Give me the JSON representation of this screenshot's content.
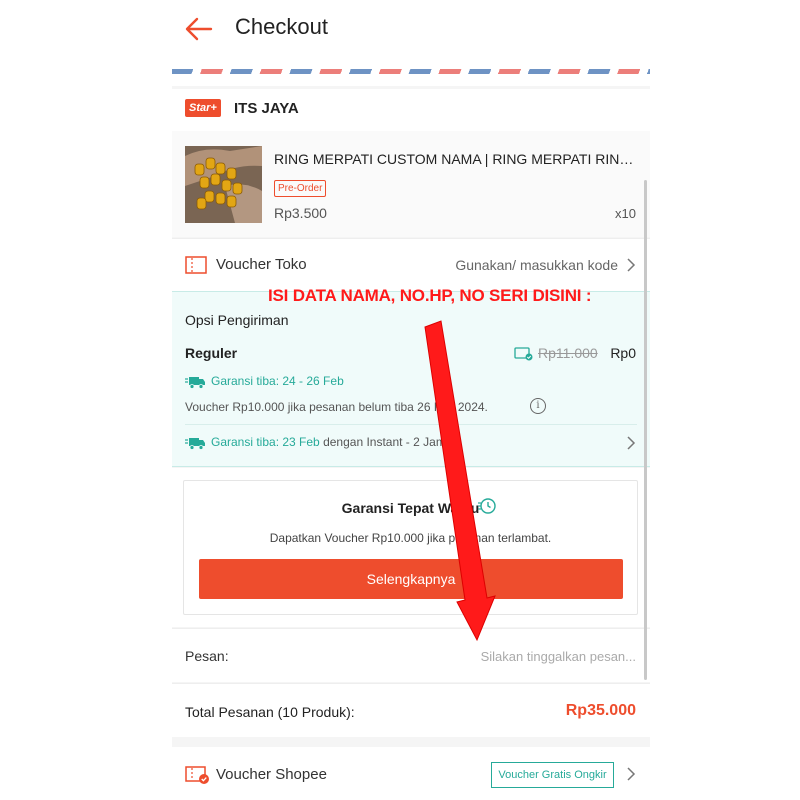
{
  "header": {
    "title": "Checkout"
  },
  "shop": {
    "badge": "Star+",
    "name": "ITS JAYA"
  },
  "product": {
    "name": "RING MERPATI CUSTOM NAMA | RING MERPATI RING MERPATI",
    "tag": "Pre-Order",
    "price": "Rp3.500",
    "qty": "x10"
  },
  "voucher_toko": {
    "label": "Voucher Toko",
    "value": "Gunakan/ masukkan kode"
  },
  "shipping": {
    "title": "Opsi Pengiriman",
    "method": "Reguler",
    "old_price": "Rp11.000",
    "new_price": "Rp0",
    "guarantee1": "Garansi tiba: 24 - 26 Feb",
    "note": "Voucher Rp10.000 jika pesanan belum tiba 26 Feb 2024.",
    "guarantee2_teal": "Garansi tiba: 23 Feb",
    "guarantee2_rest": " dengan Instant - 2 Jam"
  },
  "garansi": {
    "title": "Garansi Tepat Waktu",
    "subtitle": "Dapatkan Voucher Rp10.000 jika pesanan terlambat.",
    "button": "Selengkapnya"
  },
  "pesan": {
    "label": "Pesan:",
    "placeholder": "Silakan tinggalkan pesan..."
  },
  "total": {
    "label": "Total Pesanan (10 Produk):",
    "value": "Rp35.000"
  },
  "voucher_shopee": {
    "label": "Voucher Shopee",
    "badge": "Voucher Gratis Ongkir"
  },
  "annotation": {
    "text": "ISI DATA NAMA, NO.HP, NO SERI DISINI :"
  },
  "colors": {
    "brand": "#ee4d2d",
    "teal": "#26aa99",
    "annotation": "#ff1a1a"
  },
  "icons": {
    "back": "arrow-left-icon",
    "voucher_toko": "ticket-icon",
    "shipping_voucher": "ticket-check-icon",
    "truck": "truck-icon",
    "info": "info-icon",
    "clock": "clock-icon",
    "voucher_shopee": "voucher-check-icon",
    "chevron": "chevron-right-icon"
  }
}
